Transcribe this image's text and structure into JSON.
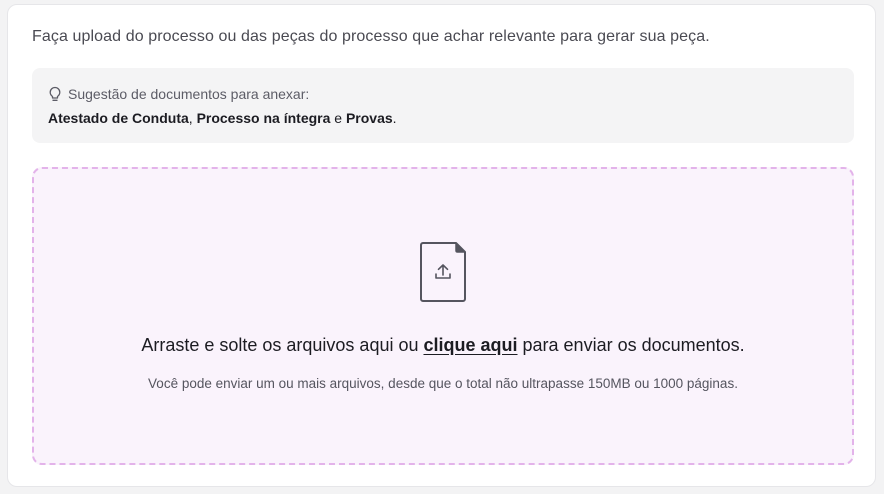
{
  "instruction": "Faça upload do processo ou das peças do processo que achar relevante para gerar sua peça.",
  "suggestion": {
    "icon": "lightbulb-icon",
    "title": "Sugestão de documentos para anexar:",
    "docs": [
      "Atestado de Conduta",
      "Processo na íntegra",
      "Provas"
    ],
    "sep_comma": ", ",
    "sep_and": " e ",
    "end": "."
  },
  "dropzone": {
    "icon": "file-upload-icon",
    "main_before": "Arraste e solte os arquivos aqui ou ",
    "main_link": "clique aqui",
    "main_after": " para enviar os documentos.",
    "sub": "Você pode enviar um ou mais arquivos, desde que o total não ultrapasse 150MB ou 1000 páginas."
  },
  "colors": {
    "dropzone_bg": "#faf3fc",
    "dropzone_border": "#e3b3ea",
    "suggestion_bg": "#f4f4f5"
  }
}
